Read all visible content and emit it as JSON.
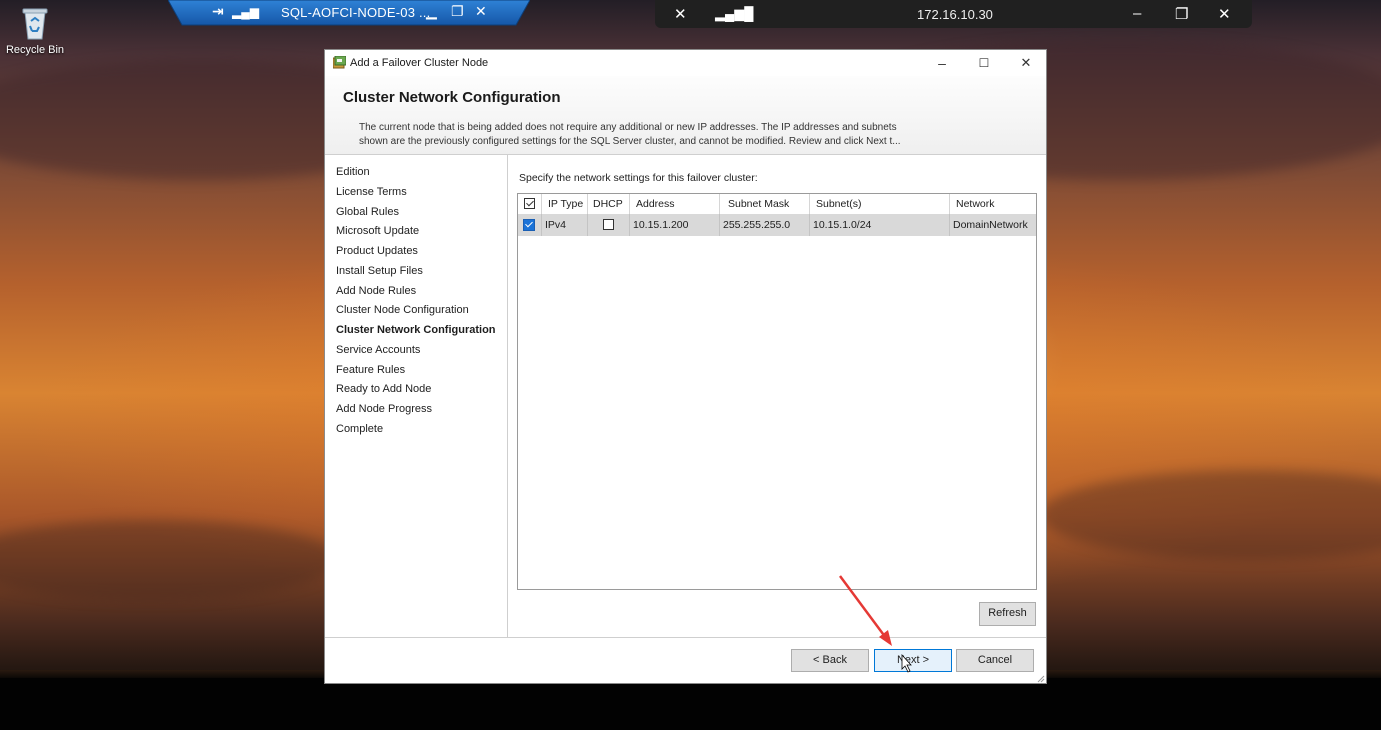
{
  "desktop": {
    "recycle_bin_label": "Recycle Bin"
  },
  "rdp_session_bar": {
    "title": "SQL-AOFCI-NODE-03 ...",
    "icons": [
      "pin-icon",
      "signal-icon",
      "minimize-icon",
      "restore-icon",
      "close-icon"
    ]
  },
  "remote_connection_bar": {
    "address": "172.16.10.30",
    "icons": [
      "unpin-icon",
      "signal-bars-icon",
      "minimize-icon",
      "restore-icon",
      "close-icon"
    ]
  },
  "window": {
    "title": "Add a Failover Cluster Node",
    "controls": {
      "minimize": "–",
      "maximize": "☐",
      "close": "✕"
    },
    "header": {
      "heading": "Cluster Network Configuration",
      "description_line1": "The current node that is being added does not require any additional or new IP addresses.  The IP addresses and subnets",
      "description_line2": "shown are the previously configured settings for the SQL Server cluster, and cannot be modified. Review and click Next t..."
    },
    "nav": {
      "items": [
        {
          "label": "Edition",
          "active": false
        },
        {
          "label": "License Terms",
          "active": false
        },
        {
          "label": "Global Rules",
          "active": false
        },
        {
          "label": "Microsoft Update",
          "active": false
        },
        {
          "label": "Product Updates",
          "active": false
        },
        {
          "label": "Install Setup Files",
          "active": false
        },
        {
          "label": "Add Node Rules",
          "active": false
        },
        {
          "label": "Cluster Node Configuration",
          "active": false
        },
        {
          "label": "Cluster Network Configuration",
          "active": true
        },
        {
          "label": "Service Accounts",
          "active": false
        },
        {
          "label": "Feature Rules",
          "active": false
        },
        {
          "label": "Ready to Add Node",
          "active": false
        },
        {
          "label": "Add Node Progress",
          "active": false
        },
        {
          "label": "Complete",
          "active": false
        }
      ]
    },
    "content": {
      "instruction": "Specify the network settings for this failover cluster:",
      "grid": {
        "select_all_checked": true,
        "columns": [
          "IP Type",
          "DHCP",
          "Address",
          "Subnet Mask",
          "Subnet(s)",
          "Network"
        ],
        "rows": [
          {
            "selected": true,
            "ip_type": "IPv4",
            "dhcp": false,
            "address": "10.15.1.200",
            "subnet_mask": "255.255.255.0",
            "subnets": "10.15.1.0/24",
            "network": "DomainNetwork"
          }
        ]
      },
      "refresh_label": "Refresh"
    },
    "footer": {
      "back_label": "< Back",
      "next_label": "Next >",
      "cancel_label": "Cancel"
    }
  },
  "colors": {
    "accent_blue": "#0078d7",
    "selection_row": "#d9d9d9",
    "annotation_arrow": "#e53935"
  }
}
